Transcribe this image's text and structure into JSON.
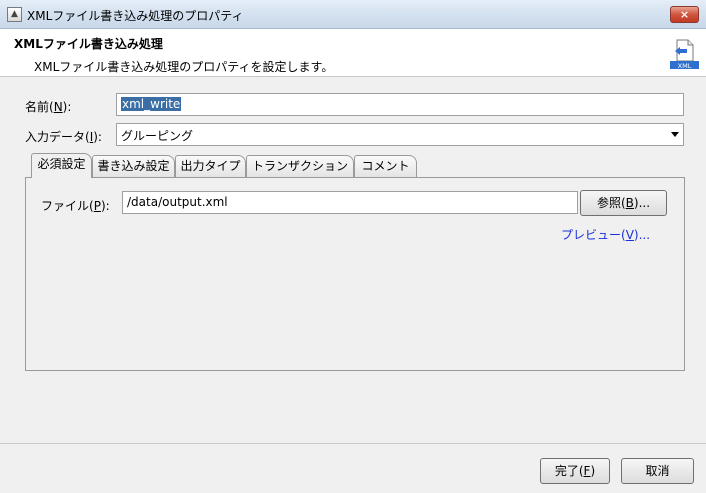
{
  "window": {
    "title": "XMLファイル書き込み処理のプロパティ",
    "close_label": "×"
  },
  "header": {
    "title": "XMLファイル書き込み処理",
    "description": "XMLファイル書き込み処理のプロパティを設定します。",
    "icon_text": "XML"
  },
  "form": {
    "name_label": "名前(",
    "name_mnemonic": "N",
    "name_suffix": "):",
    "name_value": "xml_write",
    "input_label": "入力データ(",
    "input_mnemonic": "I",
    "input_suffix": "):",
    "input_value": "グルーピング"
  },
  "tabs": [
    {
      "label": "必須設定"
    },
    {
      "label": "書き込み設定"
    },
    {
      "label": "出力タイプ"
    },
    {
      "label": "トランザクション"
    },
    {
      "label": "コメント"
    }
  ],
  "required": {
    "file_label": "ファイル(",
    "file_mnemonic": "P",
    "file_suffix": "):",
    "file_value": "/data/output.xml",
    "browse_label": "参照(",
    "browse_mnemonic": "B",
    "browse_suffix": ")...",
    "preview_label": "プレビュー(",
    "preview_mnemonic": "V",
    "preview_suffix": ")..."
  },
  "footer": {
    "ok_label": "完了(",
    "ok_mnemonic": "F",
    "ok_suffix": ")",
    "cancel_label": "取消"
  },
  "colors": {
    "selection": "#3a6ea5",
    "link": "#1a2fd8",
    "close": "#c23a22"
  }
}
